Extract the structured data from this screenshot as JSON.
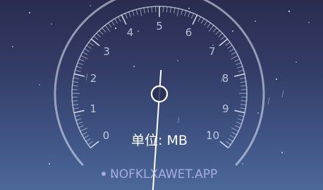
{
  "speed_gauge": {
    "scale_labels": [
      "0",
      "1",
      "2",
      "3",
      "4",
      "5",
      "6",
      "7",
      "8",
      "9",
      "10"
    ],
    "min": 0,
    "max": 10,
    "needle_value": 5.15,
    "unit_text": "单位: MB"
  },
  "watermark": {
    "text": "NOFKLXAWET.APP"
  },
  "colors": {
    "background_top": "#292c4f",
    "background_bottom": "#4b6899",
    "gauge_line": "#e6ecfb",
    "tick_label": "#dee6f8"
  }
}
